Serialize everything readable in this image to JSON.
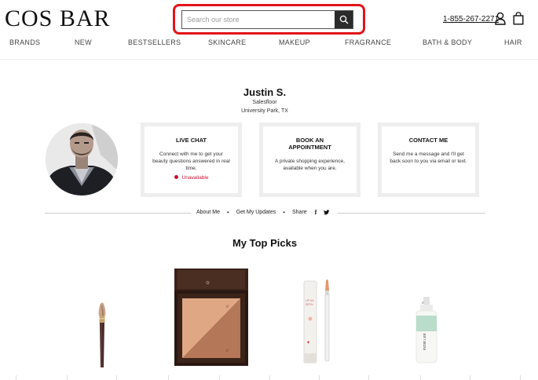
{
  "header": {
    "logo": "COS BAR",
    "search": {
      "placeholder": "Search our store",
      "value": ""
    },
    "phone": "1-855-267-2271"
  },
  "nav": {
    "items": [
      {
        "label": "BRANDS"
      },
      {
        "label": "NEW"
      },
      {
        "label": "BESTSELLERS"
      },
      {
        "label": "SKINCARE"
      },
      {
        "label": "MAKEUP"
      },
      {
        "label": "FRAGRANCE"
      },
      {
        "label": "BATH & BODY"
      },
      {
        "label": "HAIR"
      }
    ]
  },
  "profile": {
    "name": "Justin S.",
    "role": "Salesfloor",
    "location": "University Park, TX"
  },
  "cards": [
    {
      "title": "LIVE CHAT",
      "desc": "Connect with me to get your beauty questions answered in real time.",
      "status": "Unavailable"
    },
    {
      "title": "BOOK AN APPOINTMENT",
      "desc": "A private shopping experience, available when you are."
    },
    {
      "title": "CONTACT ME",
      "desc": "Send me a message and I'll get back soon to you via email or text."
    }
  ],
  "profile_links": {
    "about": "About Me",
    "updates": "Get My Updates",
    "share": "Share",
    "facebook": "f",
    "twitter": "t"
  },
  "picks": {
    "title": "My Top Picks",
    "products": [
      {
        "icon": "makeup-brush-icon"
      },
      {
        "icon": "bronzer-compact-icon"
      },
      {
        "icon": "lip-kit-icon"
      },
      {
        "icon": "spray-bottle-icon"
      }
    ]
  },
  "colors": {
    "highlight": "#e2141a",
    "unavailable": "#c8102e",
    "search_button": "#2b2b2b"
  }
}
